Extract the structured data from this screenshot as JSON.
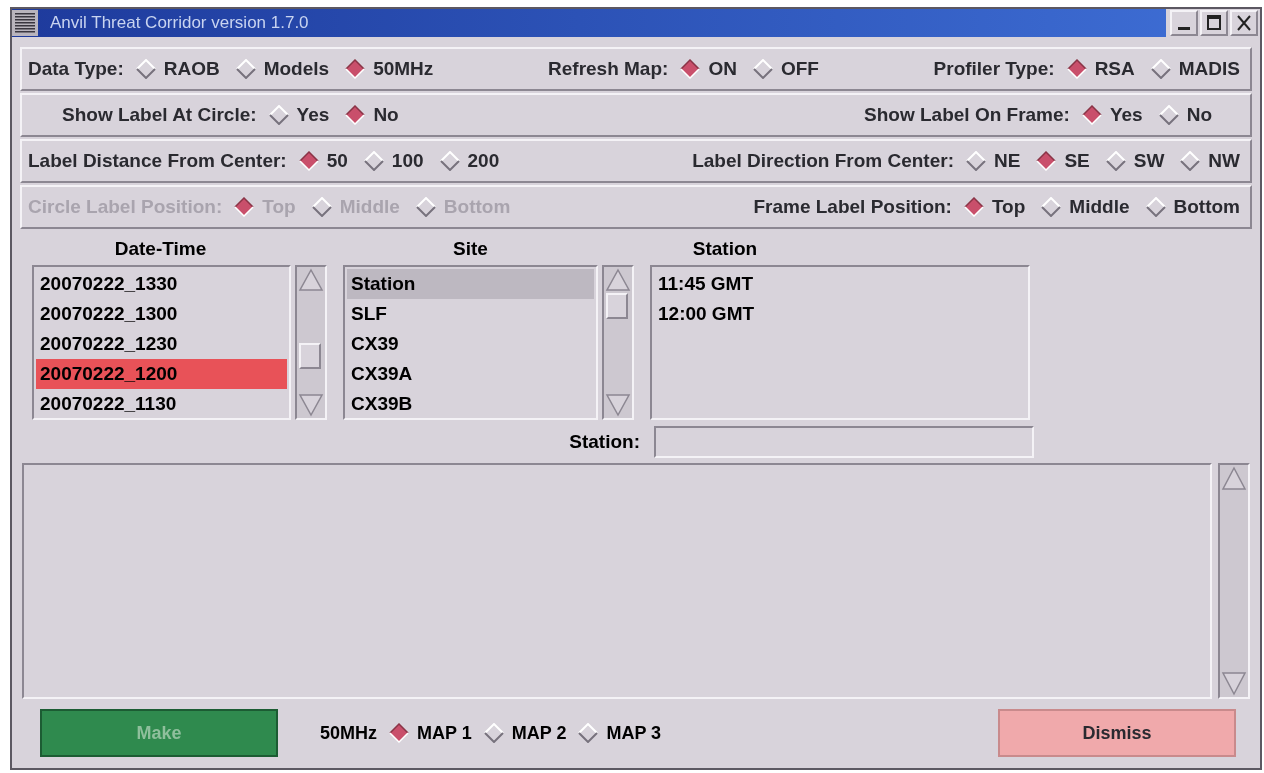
{
  "window": {
    "title": "Anvil Threat Corridor version 1.7.0"
  },
  "option_rows": [
    {
      "groups": [
        {
          "label": "Data Type:",
          "disabled": false,
          "options": [
            {
              "label": "RAOB",
              "selected": false
            },
            {
              "label": "Models",
              "selected": false
            },
            {
              "label": "50MHz",
              "selected": true
            }
          ]
        },
        {
          "label": "Refresh Map:",
          "disabled": false,
          "options": [
            {
              "label": "ON",
              "selected": true
            },
            {
              "label": "OFF",
              "selected": false
            }
          ]
        },
        {
          "label": "Profiler Type:",
          "disabled": false,
          "options": [
            {
              "label": "RSA",
              "selected": true
            },
            {
              "label": "MADIS",
              "selected": false
            }
          ]
        }
      ]
    },
    {
      "groups": [
        {
          "label": "Show Label At Circle:",
          "disabled": false,
          "options": [
            {
              "label": "Yes",
              "selected": false
            },
            {
              "label": "No",
              "selected": true
            }
          ]
        },
        {
          "label": "Show Label On Frame:",
          "disabled": false,
          "options": [
            {
              "label": "Yes",
              "selected": true
            },
            {
              "label": "No",
              "selected": false
            }
          ]
        }
      ]
    },
    {
      "groups": [
        {
          "label": "Label Distance From Center:",
          "disabled": false,
          "options": [
            {
              "label": "50",
              "selected": true
            },
            {
              "label": "100",
              "selected": false
            },
            {
              "label": "200",
              "selected": false
            }
          ]
        },
        {
          "label": "Label Direction From Center:",
          "disabled": false,
          "options": [
            {
              "label": "NE",
              "selected": false
            },
            {
              "label": "SE",
              "selected": true
            },
            {
              "label": "SW",
              "selected": false
            },
            {
              "label": "NW",
              "selected": false
            }
          ]
        }
      ]
    },
    {
      "groups": [
        {
          "label": "Circle Label Position:",
          "disabled": true,
          "options": [
            {
              "label": "Top",
              "selected": true
            },
            {
              "label": "Middle",
              "selected": false
            },
            {
              "label": "Bottom",
              "selected": false
            }
          ]
        },
        {
          "label": "Frame Label Position:",
          "disabled": false,
          "options": [
            {
              "label": "Top",
              "selected": true
            },
            {
              "label": "Middle",
              "selected": false
            },
            {
              "label": "Bottom",
              "selected": false
            }
          ]
        }
      ]
    }
  ],
  "date_time": {
    "heading": "Date-Time",
    "items": [
      {
        "text": "20070222_1330",
        "selected": false
      },
      {
        "text": "20070222_1300",
        "selected": false
      },
      {
        "text": "20070222_1230",
        "selected": false
      },
      {
        "text": "20070222_1200",
        "selected": true
      },
      {
        "text": "20070222_1130",
        "selected": false
      }
    ]
  },
  "site": {
    "heading": "Site",
    "items": [
      {
        "text": "Station",
        "selected": true
      },
      {
        "text": "SLF",
        "selected": false
      },
      {
        "text": "CX39",
        "selected": false
      },
      {
        "text": "CX39A",
        "selected": false
      },
      {
        "text": "CX39B",
        "selected": false
      }
    ]
  },
  "station": {
    "heading": "Station",
    "items": [
      {
        "text": "11:45 GMT",
        "selected": false
      },
      {
        "text": "12:00 GMT",
        "selected": false
      }
    ]
  },
  "station_field": {
    "label": "Station:"
  },
  "footer": {
    "make_button": {
      "label": "Make",
      "disabled": true
    },
    "map_group": {
      "label": "50MHz",
      "options": [
        {
          "label": "MAP 1",
          "selected": true
        },
        {
          "label": "MAP 2",
          "selected": false
        },
        {
          "label": "MAP 3",
          "selected": false
        }
      ]
    },
    "dismiss_button": {
      "label": "Dismiss"
    }
  }
}
